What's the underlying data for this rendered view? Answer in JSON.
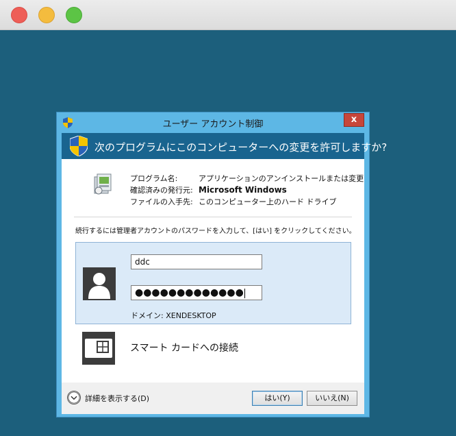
{
  "dialog": {
    "title": "ユーザー アカウント制御",
    "close_label": "x",
    "question": "次のプログラムにこのコンピューターへの変更を許可しますか?"
  },
  "program_info": {
    "rows": [
      {
        "label": "プログラム名:",
        "value": "アプリケーションのアンインストールまたは変更"
      },
      {
        "label": "確認済みの発行元:",
        "value": "Microsoft Windows"
      },
      {
        "label": "ファイルの入手先:",
        "value": "このコンピューター上のハード ドライブ"
      }
    ]
  },
  "instruction": "続行するには管理者アカウントのパスワードを入力して、[はい] をクリックしてください。",
  "credentials": {
    "username": "ddc",
    "password_mask": "●●●●●●●●●●●●●",
    "domain": "ドメイン: XENDESKTOP"
  },
  "smartcard": {
    "label": "スマート カードへの接続"
  },
  "footer": {
    "details_label": "詳細を表示する(D)",
    "yes_label": "はい(Y)",
    "no_label": "いいえ(N)"
  },
  "colors": {
    "desktop": "#1c5f7c",
    "dialog_frame": "#5db7e5",
    "banner": "#19648f",
    "close_button": "#c7463a",
    "tile_selected": "#dbeaf8"
  }
}
